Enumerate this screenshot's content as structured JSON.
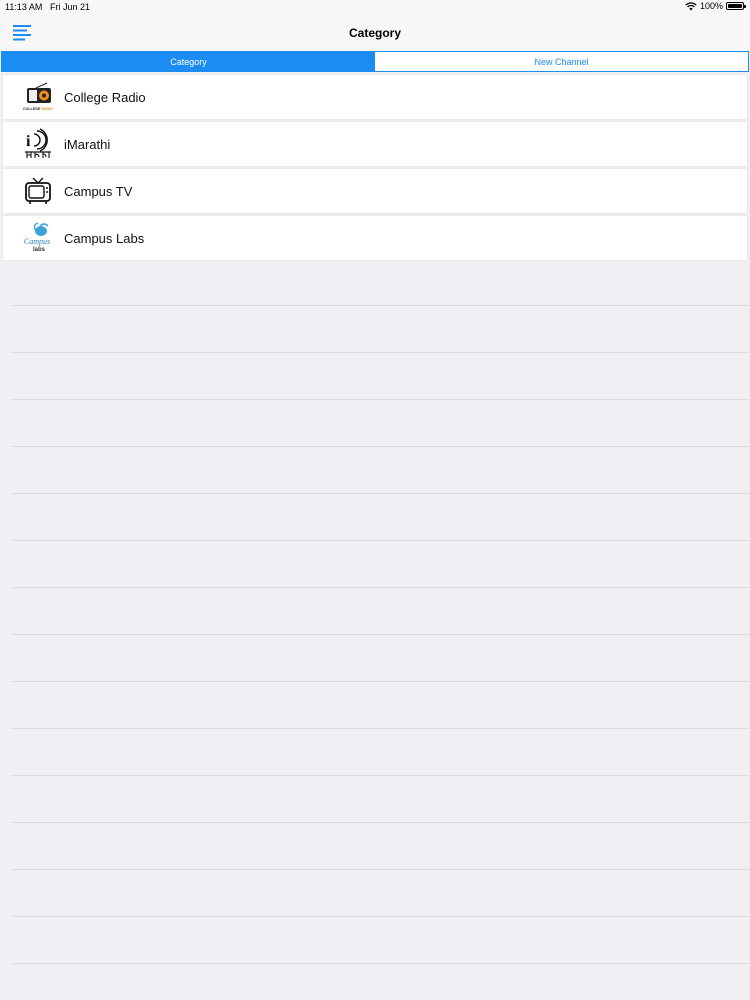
{
  "statusbar": {
    "time": "11:13 AM",
    "date": "Fri Jun 21",
    "battery": "100%"
  },
  "navbar": {
    "title": "Category"
  },
  "segments": [
    {
      "label": "Category",
      "active": true
    },
    {
      "label": "New Channel",
      "active": false
    }
  ],
  "items": [
    {
      "label": "College Radio",
      "icon": "radio-icon",
      "icon_caption": "COLLEGE RADIO"
    },
    {
      "label": "iMarathi",
      "icon": "imarathi-logo-icon",
      "icon_caption": "मराठी"
    },
    {
      "label": "Campus TV",
      "icon": "tv-icon"
    },
    {
      "label": "Campus Labs",
      "icon": "campus-labs-logo-icon",
      "icon_caption": "Campus labs"
    }
  ],
  "colors": {
    "accent": "#1a8cf2",
    "background": "#efeff4"
  }
}
